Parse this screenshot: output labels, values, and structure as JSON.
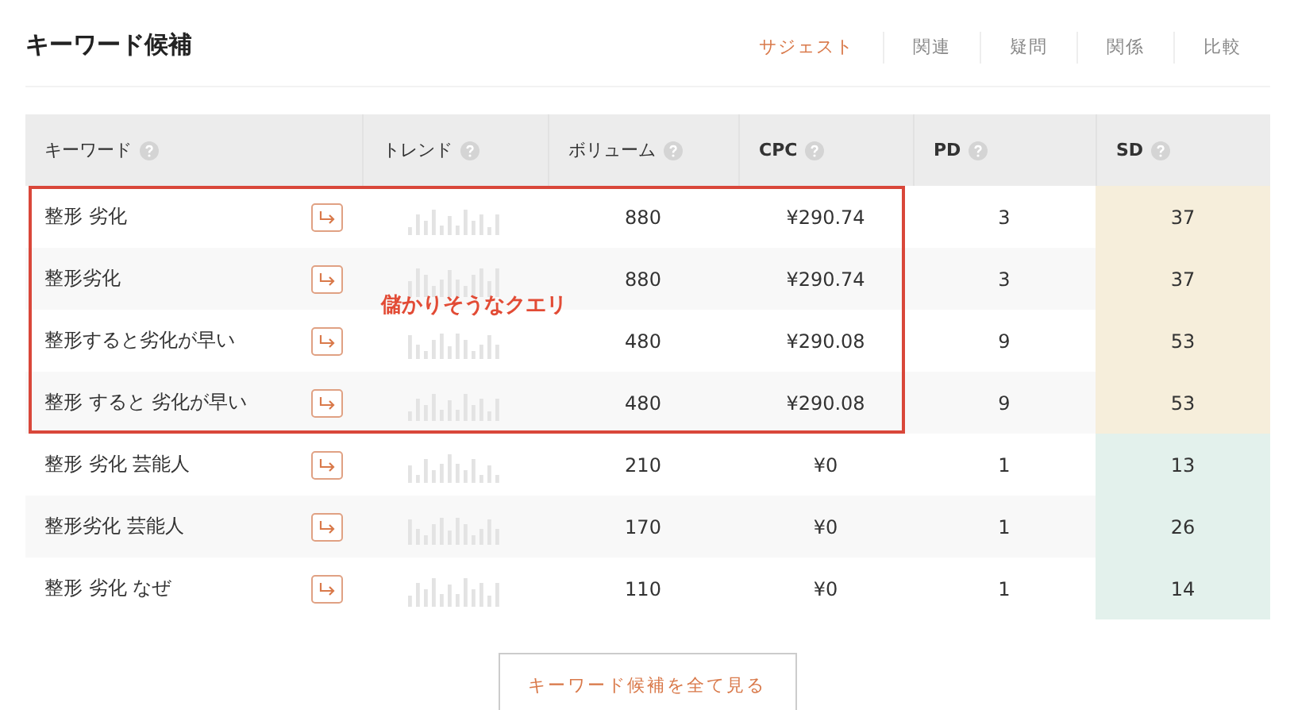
{
  "title": "キーワード候補",
  "tabs": [
    {
      "label": "サジェスト",
      "selected": true
    },
    {
      "label": "関連",
      "selected": false
    },
    {
      "label": "疑問",
      "selected": false
    },
    {
      "label": "関係",
      "selected": false
    },
    {
      "label": "比較",
      "selected": false
    }
  ],
  "table": {
    "columns": [
      {
        "label": "キーワード",
        "bold": false
      },
      {
        "label": "トレンド",
        "bold": false
      },
      {
        "label": "ボリューム",
        "bold": false
      },
      {
        "label": "CPC",
        "bold": true
      },
      {
        "label": "PD",
        "bold": true
      },
      {
        "label": "SD",
        "bold": true
      }
    ],
    "groups": [
      {
        "annotation": "儲かりそうなクエリ",
        "rows": [
          {
            "keyword": "整形 劣化",
            "volume": "880",
            "cpc": "¥290.74",
            "pd": "3",
            "sd": "37",
            "color": "#f6eedb"
          },
          {
            "keyword": "整形劣化",
            "volume": "880",
            "cpc": "¥290.74",
            "pd": "3",
            "sd": "37",
            "color": "#f6eedb"
          },
          {
            "keyword": "整形すると劣化が早い",
            "volume": "480",
            "cpc": "¥290.08",
            "pd": "9",
            "sd": "53",
            "color": "#f6eedb"
          },
          {
            "keyword": "整形 すると 劣化が早い",
            "volume": "480",
            "cpc": "¥290.08",
            "pd": "9",
            "sd": "53",
            "color": "#f6eedb"
          }
        ]
      },
      {
        "rows": [
          {
            "keyword": "整形 劣化 芸能人",
            "volume": "210",
            "cpc": "¥0",
            "pd": "1",
            "sd": "13",
            "color": "#e3f1ec"
          },
          {
            "keyword": "整形劣化 芸能人",
            "volume": "170",
            "cpc": "¥0",
            "pd": "1",
            "sd": "26",
            "color": "#e3f1ec"
          },
          {
            "keyword": "整形 劣化 なぜ",
            "volume": "110",
            "cpc": "¥0",
            "pd": "1",
            "sd": "14",
            "color": "#e3f1ec"
          }
        ]
      }
    ]
  },
  "more_button": "キーワード候補を全て見る"
}
